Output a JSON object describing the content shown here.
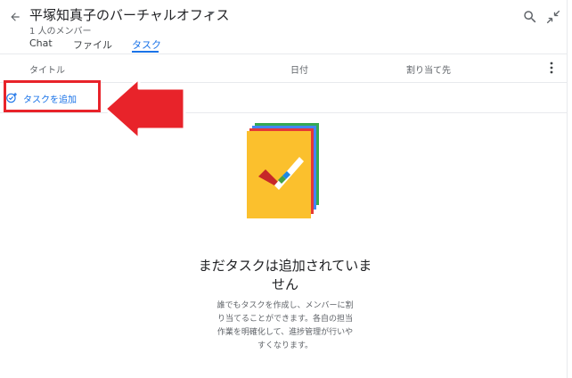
{
  "header": {
    "title": "平塚知真子のバーチャルオフィス",
    "subtitle": "1 人のメンバー"
  },
  "tabs": [
    {
      "label": "Chat"
    },
    {
      "label": "ファイル"
    },
    {
      "label": "タスク",
      "active": true
    }
  ],
  "table": {
    "columns": [
      "タイトル",
      "日付",
      "割り当て先"
    ]
  },
  "add_task": {
    "label": "タスクを追加"
  },
  "empty_state": {
    "title": "まだタスクは追加されていません",
    "description": "誰でもタスクを作成し、メンバーに割り当てることができます。各自の担当作業を明確化して、進捗管理が行いやすくなります。"
  },
  "colors": {
    "accent": "#1a73e8",
    "highlight": "#e8232a"
  }
}
